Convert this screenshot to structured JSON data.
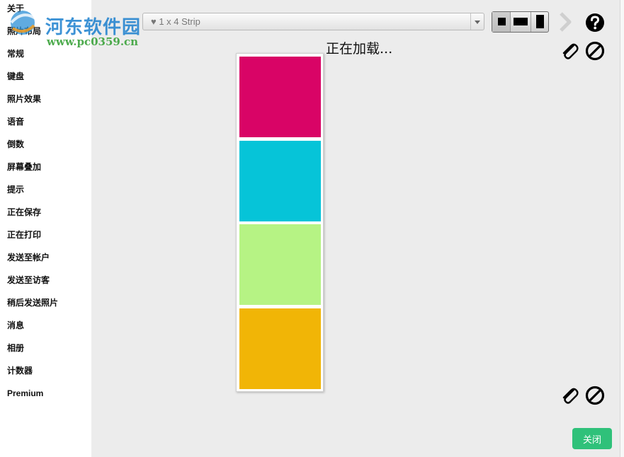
{
  "sidebar": {
    "items": [
      {
        "label": "关于"
      },
      {
        "label": "照片布局"
      },
      {
        "label": "常规"
      },
      {
        "label": "键盘"
      },
      {
        "label": "照片效果"
      },
      {
        "label": "语音"
      },
      {
        "label": "倒数"
      },
      {
        "label": "屏幕叠加"
      },
      {
        "label": "提示"
      },
      {
        "label": "正在保存"
      },
      {
        "label": "正在打印"
      },
      {
        "label": "发送至帐户"
      },
      {
        "label": "发送至访客"
      },
      {
        "label": "稍后发送照片"
      },
      {
        "label": "消息"
      },
      {
        "label": "相册"
      },
      {
        "label": "计数器"
      },
      {
        "label": "Premium"
      }
    ]
  },
  "watermark": {
    "title": "河东软件园",
    "url": "www.pc0359.cn"
  },
  "toolbar": {
    "layout_value": "♥ 1 x 4 Strip",
    "icons": [
      "square-icon",
      "landscape-icon",
      "portrait-icon",
      "chevron-right-icon",
      "help-icon"
    ]
  },
  "main": {
    "loading_text": "正在加载...",
    "photo_colors": [
      "#d90466",
      "#06c4d8",
      "#b6f384",
      "#f1b506"
    ]
  },
  "footer": {
    "close_label": "关闭"
  },
  "colors": {
    "accent_green": "#2fc17a",
    "sidebar_bg": "#ffffff",
    "main_bg": "#ececec"
  }
}
